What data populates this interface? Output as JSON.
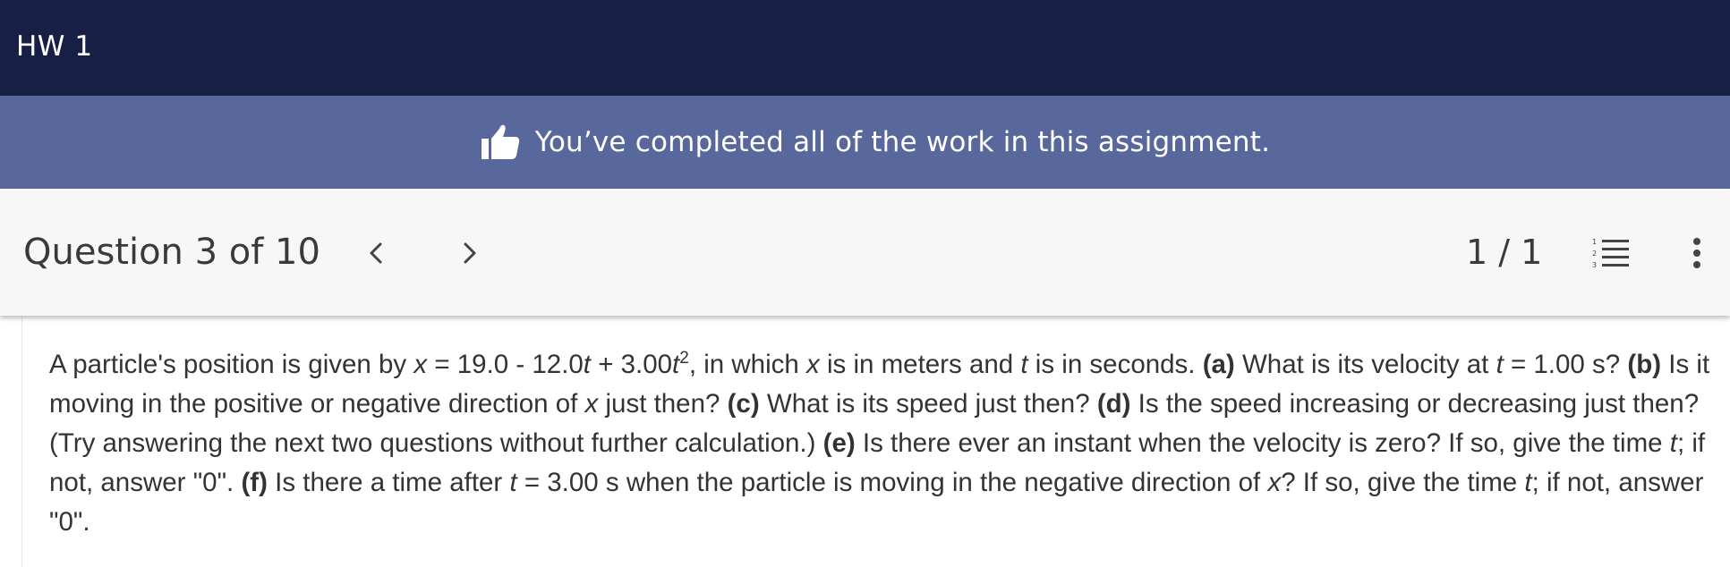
{
  "header": {
    "title": "HW 1"
  },
  "banner": {
    "icon": "thumbs-up-icon",
    "message": "You’ve completed all of the work in this assignment.",
    "background": "#58679c"
  },
  "question_bar": {
    "label": "Question 3 of 10",
    "prev_icon": "chevron-left-icon",
    "next_icon": "chevron-right-icon",
    "progress": "1 / 1",
    "list_icon": "numbered-list-icon",
    "more_icon": "more-vertical-icon"
  },
  "question": {
    "t1": "A particle's position is given by ",
    "v_x1": "x",
    "t2": " = 19.0 - 12.0",
    "v_t1": "t",
    "t3": " + 3.00",
    "v_t2": "t",
    "sup2": "2",
    "t4": ", in which ",
    "v_x2": "x",
    "t5": " is in meters and ",
    "v_t3": "t",
    "t6": " is in seconds. ",
    "a": "(a)",
    "t7": " What is its velocity at ",
    "v_t4": "t",
    "t8": " = 1.00 s? ",
    "b": "(b)",
    "t9": " Is it moving in the positive or negative direction of ",
    "v_x3": "x",
    "t10": " just then? ",
    "c": "(c)",
    "t11": " What is its speed just then? ",
    "d": "(d)",
    "t12": " Is the speed increasing or decreasing just then? (Try answering the next two questions without further calculation.) ",
    "e": "(e)",
    "t13": " Is there ever an instant when the velocity is zero? If so, give the time ",
    "v_t5": "t",
    "t14": "; if not, answer \"0\". ",
    "f": "(f)",
    "t15": " Is there a time after ",
    "v_t6": "t",
    "t16": " = 3.00 s when the particle is moving in the negative direction of ",
    "v_x4": "x",
    "t17": "? If so, give the time ",
    "v_t7": "t",
    "t18": "; if not, answer \"0\"."
  }
}
